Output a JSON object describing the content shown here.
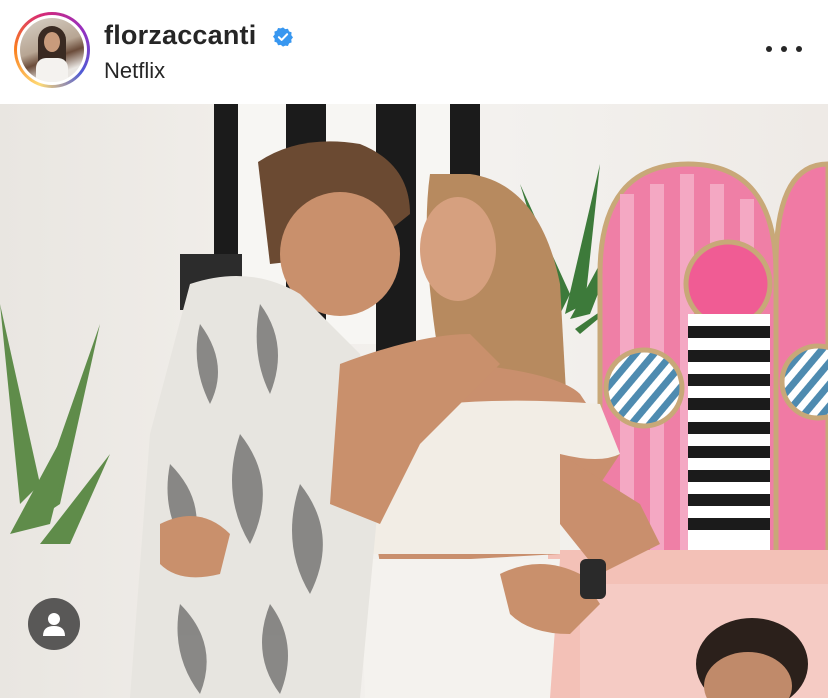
{
  "post": {
    "username": "florzaccanti",
    "subtitle": "Netflix",
    "verified": true
  },
  "icons": {
    "verified": "verified-badge-icon",
    "more": "more-options-icon",
    "user_tag": "user-tag-icon"
  },
  "colors": {
    "verified_blue": "#3897f0",
    "text": "#262626",
    "tag_bg": "#282828"
  }
}
